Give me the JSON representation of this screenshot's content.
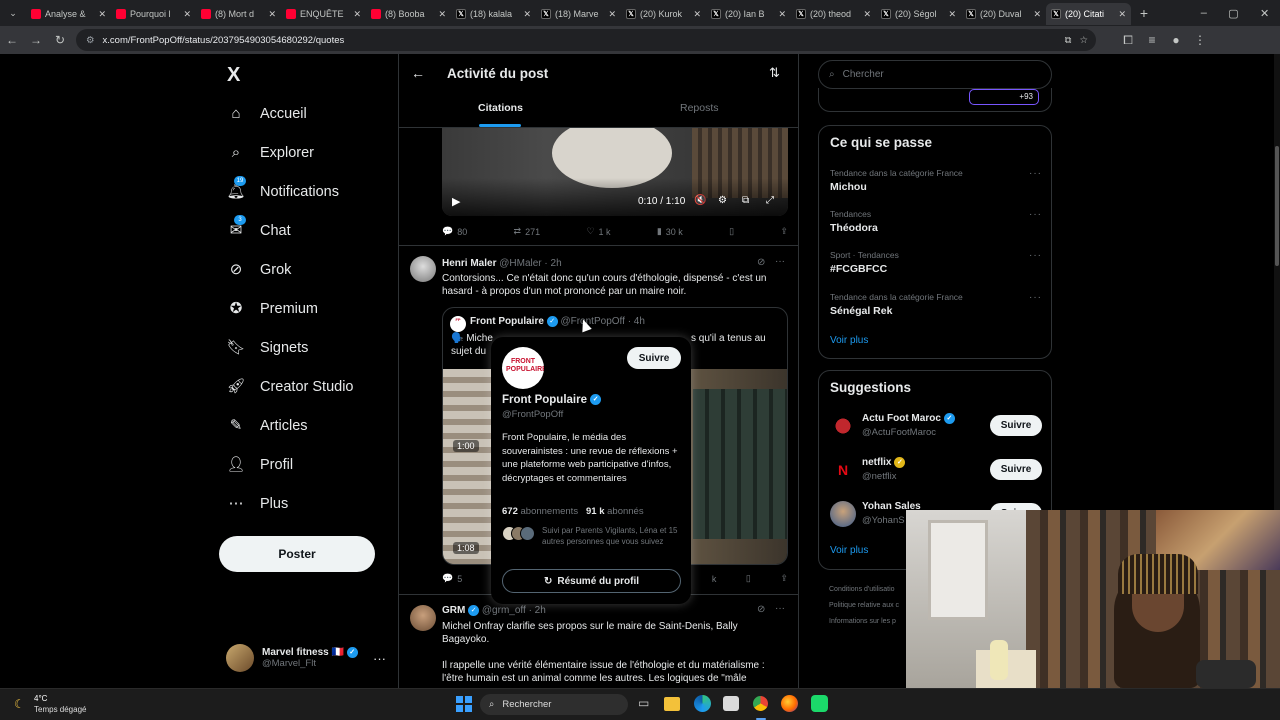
{
  "browser": {
    "tabs": [
      {
        "label": "Analyse &",
        "kind": "yt"
      },
      {
        "label": "Pourquoi l",
        "kind": "yt"
      },
      {
        "label": "(8) Mort d",
        "kind": "yt"
      },
      {
        "label": "ENQUÊTE",
        "kind": "yt"
      },
      {
        "label": "(8) Booba",
        "kind": "yt"
      },
      {
        "label": "(18) kalala",
        "kind": "x"
      },
      {
        "label": "(18) Marve",
        "kind": "x"
      },
      {
        "label": "(20) Kurok",
        "kind": "x"
      },
      {
        "label": "(20) Ian B",
        "kind": "x"
      },
      {
        "label": "(20) theod",
        "kind": "x"
      },
      {
        "label": "(20) Ségol",
        "kind": "x"
      },
      {
        "label": "(20) Duval",
        "kind": "x"
      },
      {
        "label": "(20) Citati",
        "kind": "x",
        "active": true
      }
    ],
    "url": "x.com/FrontPopOff/status/2037954903054680292/quotes"
  },
  "nav": {
    "logo": "X",
    "items": [
      {
        "label": "Accueil",
        "icon": "home-icon"
      },
      {
        "label": "Explorer",
        "icon": "search-icon"
      },
      {
        "label": "Notifications",
        "icon": "bell-icon",
        "badge": "19"
      },
      {
        "label": "Chat",
        "icon": "mail-icon",
        "badge": "3"
      },
      {
        "label": "Grok",
        "icon": "grok-icon"
      },
      {
        "label": "Premium",
        "icon": "premium-icon"
      },
      {
        "label": "Signets",
        "icon": "bookmark-icon"
      },
      {
        "label": "Creator Studio",
        "icon": "rocket-icon"
      },
      {
        "label": "Articles",
        "icon": "articles-icon"
      },
      {
        "label": "Profil",
        "icon": "person-icon"
      },
      {
        "label": "Plus",
        "icon": "more-circle-icon"
      }
    ],
    "post_button": "Poster",
    "account": {
      "name": "Marvel fitness 🇫🇷",
      "handle": "@Marvel_Flt"
    }
  },
  "header": {
    "title": "Activité du post",
    "tabs": [
      "Citations",
      "Reposts"
    ]
  },
  "video1": {
    "time": "0:10 / 1:10",
    "stats": {
      "replies": "80",
      "reposts": "271",
      "likes": "1 k",
      "views": "30 k"
    }
  },
  "tweet1": {
    "name": "Henri Maler",
    "handle": "@HMaler",
    "time": "· 2h",
    "text": "Contorsions... Ce n'était donc qu'un cours d'éthologie, dispensé - c'est un hasard - à propos d'un mot prononcé par un maire noir.",
    "quote": {
      "name": "Front Populaire",
      "handle": "@FrontPopOff",
      "time": "· 4h",
      "text_start": "🗣️ Miche",
      "text_end": "s qu'il a tenus au",
      "text_line2": "sujet du",
      "video_badge": "1:00",
      "video_time": "1:08"
    },
    "stats": {
      "replies": "5",
      "views": "k"
    }
  },
  "hover_card": {
    "avatar_text": "FRONT POPULAIRE",
    "follow": "Suivre",
    "name": "Front Populaire",
    "handle": "@FrontPopOff",
    "bio": "Front Populaire, le média des souverainistes : une revue de réflexions + une plateforme web participative d'infos, décryptages et commentaires",
    "following_count": "672",
    "following_label": "abonnements",
    "followers_count": "91 k",
    "followers_label": "abonnés",
    "followed_by": "Suivi par Parents Vigilants, Léna et 15 autres personnes que vous suivez",
    "profile_summary": "Résumé du profil"
  },
  "tweet2": {
    "name": "GRM",
    "handle": "@grm_off",
    "time": "· 2h",
    "text1": "Michel Onfray clarifie ses propos sur le maire de Saint-Denis, Bally Bagayoko.",
    "text2": "Il rappelle une vérité élémentaire issue de l'éthologie et du matérialisme : l'être humain est un animal comme les autres. Les logiques de \"mâle"
  },
  "right": {
    "search_placeholder": "Chercher",
    "top_partial": "+93",
    "trends_title": "Ce qui se passe",
    "trends": [
      {
        "category": "Tendance dans la catégorie France",
        "name": "Michou"
      },
      {
        "category": "Tendances",
        "name": "Théodora"
      },
      {
        "category": "Sport · Tendances",
        "name": "#FCGBFCC"
      },
      {
        "category": "Tendance dans la catégorie France",
        "name": "Sénégal Rek"
      }
    ],
    "trends_more": "Voir plus",
    "suggestions_title": "Suggestions",
    "suggestions": [
      {
        "name": "Actu Foot Maroc",
        "handle": "@ActuFootMaroc",
        "button": "Suivre"
      },
      {
        "name": "netflix",
        "handle": "@netflix",
        "button": "Suivre"
      },
      {
        "name": "Yohan Sales",
        "handle": "@YohanS",
        "button": "Suivre"
      }
    ],
    "suggestions_more": "Voir plus",
    "footer": [
      "Conditions d'utilisatio",
      "Politique relative aux c",
      "Informations sur les p"
    ]
  },
  "taskbar": {
    "weather_temp": "4°C",
    "weather_desc": "Temps dégagé",
    "search": "Rechercher"
  }
}
